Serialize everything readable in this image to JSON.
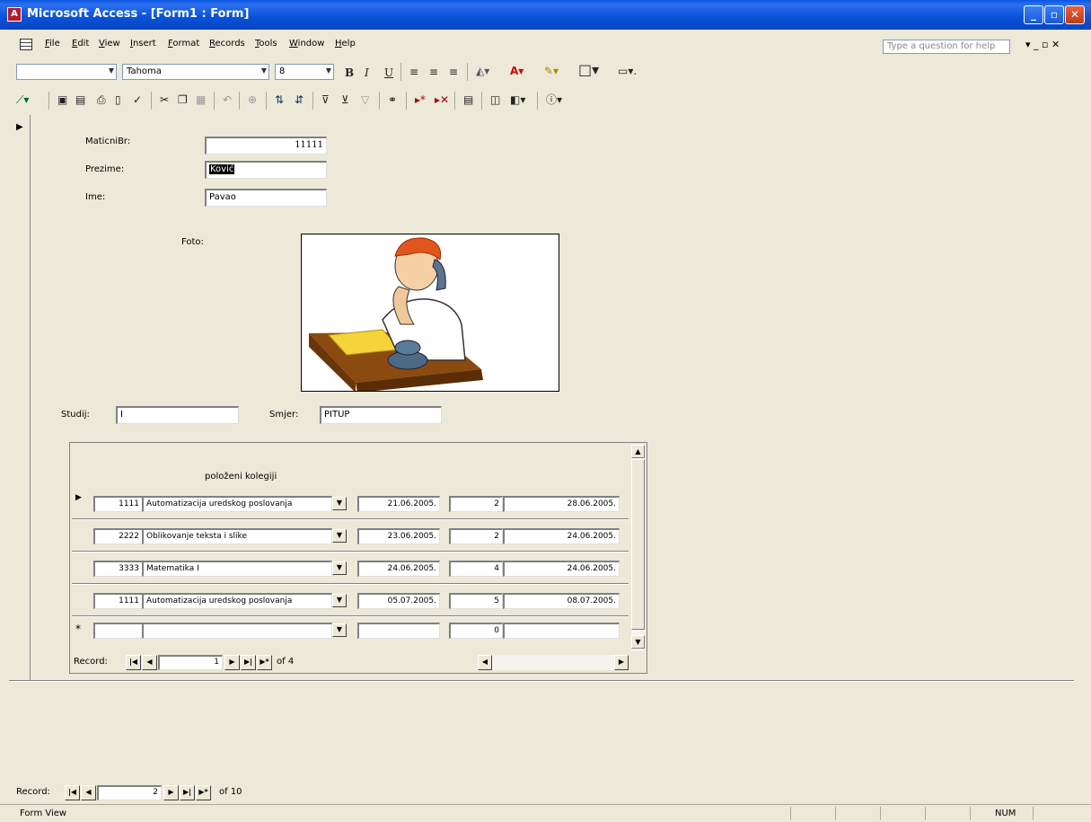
{
  "window": {
    "title": "Microsoft Access - [Form1 : Form]",
    "minimize_glyph": "_",
    "maximize_glyph": "▫",
    "close_glyph": "✕"
  },
  "menu": {
    "items": [
      "File",
      "Edit",
      "View",
      "Insert",
      "Format",
      "Records",
      "Tools",
      "Window",
      "Help"
    ],
    "help_placeholder": "Type a question for help",
    "mdi_controls": "▾  _  ▫  ✕"
  },
  "format_toolbar": {
    "object_combo": "",
    "font": "Tahoma",
    "font_size": "8",
    "bold": "B",
    "italic": "I",
    "underline": "U"
  },
  "form": {
    "fields": {
      "maticni_label": "MaticniBr:",
      "maticni_value": "11111",
      "prezime_label": "Prezime:",
      "prezime_value": "Ković",
      "ime_label": "Ime:",
      "ime_value": "Pavao",
      "foto_label": "Foto:",
      "studij_label": "Studij:",
      "studij_value": "I",
      "smjer_label": "Smjer:",
      "smjer_value": "PITUP"
    },
    "subform": {
      "title": "položeni kolegiji",
      "rows": [
        {
          "code": "1111",
          "course": "Automatizacija uredskog poslovanja",
          "date1": "21.06.2005.",
          "grade": "2",
          "date2": "28.06.2005."
        },
        {
          "code": "2222",
          "course": "Oblikovanje teksta i slike",
          "date1": "23.06.2005.",
          "grade": "2",
          "date2": "24.06.2005."
        },
        {
          "code": "3333",
          "course": "Matematika I",
          "date1": "24.06.2005.",
          "grade": "4",
          "date2": "24.06.2005."
        },
        {
          "code": "1111",
          "course": "Automatizacija uredskog poslovanja",
          "date1": "05.07.2005.",
          "grade": "5",
          "date2": "08.07.2005."
        }
      ],
      "new_row_grade": "0",
      "nav": {
        "label": "Record:",
        "current": "1",
        "of_text": "of 4"
      }
    },
    "main_nav": {
      "label": "Record:",
      "current": "2",
      "of_text": "of 10"
    }
  },
  "status": {
    "text": "Form View",
    "num": "NUM"
  }
}
